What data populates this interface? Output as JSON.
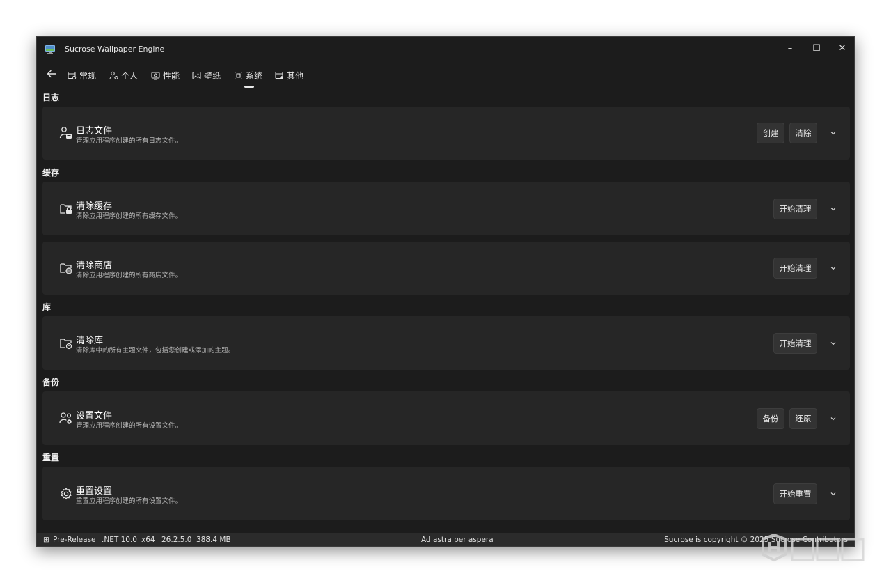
{
  "window": {
    "title": "Sucrose Wallpaper Engine",
    "controls": {
      "minimize": "–",
      "maximize": "☐",
      "close": "✕"
    }
  },
  "nav": {
    "tabs": [
      {
        "label": "常规",
        "icon": "window-settings-icon"
      },
      {
        "label": "个人",
        "icon": "personal-icon"
      },
      {
        "label": "性能",
        "icon": "performance-icon"
      },
      {
        "label": "壁纸",
        "icon": "image-icon"
      },
      {
        "label": "系统",
        "icon": "system-icon",
        "selected": true
      },
      {
        "label": "其他",
        "icon": "other-icon"
      }
    ]
  },
  "sections": {
    "log": {
      "header": "日志",
      "log_file": {
        "title": "日志文件",
        "desc": "管理应用程序创建的所有日志文件。",
        "btn_create": "创建",
        "btn_clear": "清除"
      }
    },
    "cache": {
      "header": "缓存",
      "clear_cache": {
        "title": "清除缓存",
        "desc": "清除应用程序创建的所有缓存文件。",
        "btn": "开始清理"
      },
      "clear_store": {
        "title": "清除商店",
        "desc": "清除应用程序创建的所有商店文件。",
        "btn": "开始清理"
      }
    },
    "library": {
      "header": "库",
      "clear_library": {
        "title": "清除库",
        "desc": "清除库中的所有主题文件，包括您创建或添加的主题。",
        "btn": "开始清理"
      }
    },
    "backup": {
      "header": "备份",
      "settings_file": {
        "title": "设置文件",
        "desc": "管理应用程序创建的所有设置文件。",
        "btn_backup": "备份",
        "btn_restore": "还原"
      }
    },
    "reset": {
      "header": "重置",
      "reset_settings": {
        "title": "重置设置",
        "desc": "重置应用程序创建的所有设置文件。",
        "btn": "开始重置"
      }
    }
  },
  "statusbar": {
    "release_icon": "⊞",
    "release": "Pre-Release",
    "framework": ".NET 10.0",
    "arch": "x64",
    "version": "26.2.5.0",
    "memory": "388.4 MB",
    "motto": "Ad astra per aspera",
    "copyright": "Sucrose is copyright © 2025 Sucrose Contributors"
  },
  "colors": {
    "window_bg": "#1c1c1c",
    "card_bg": "#262626",
    "button_bg": "#333333",
    "statusbar_bg": "#2b2b2b"
  }
}
